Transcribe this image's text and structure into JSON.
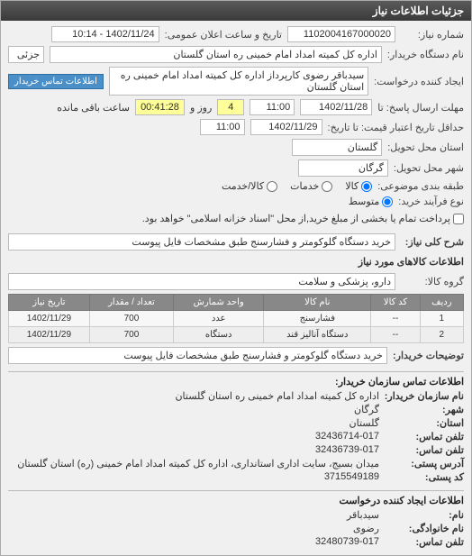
{
  "window": {
    "title": "جزئیات اطلاعات نیاز"
  },
  "header": {
    "reqNoLabel": "شماره نیاز:",
    "reqNo": "1102004167000020",
    "pubLabel": "تاریخ و ساعت اعلان عمومی:",
    "pubValue": "1402/11/24 - 10:14",
    "buyerDevLabel": "نام دستگاه خریدار:",
    "buyerDev": "اداره کل کمیته امداد امام خمینی  ره  استان گلستان",
    "partial": "جزئی",
    "creatorLabel": "ایجاد کننده درخواست:",
    "creator": "سیدباقر رضوی کارپرداز اداره کل کمیته امداد امام خمینی  ره  استان گلستان",
    "contactBtn": "اطلاعات تماس خریدار",
    "deadlineLabel": "مهلت ارسال پاسخ: تا",
    "deadlineDate": "1402/11/28",
    "deadlineTime": "11:00",
    "daysLeft": "4",
    "daysLeftSuffix": "روز و",
    "timeLeft": "00:41:28",
    "timeLeftSuffix": "ساعت باقی مانده",
    "validityLabel": "حداقل تاریخ اعتبار قیمت: تا تاریخ:",
    "validityDate": "1402/11/29",
    "validityTime": "11:00",
    "provinceLabel": "استان محل تحویل:",
    "province": "گلستان",
    "cityLabel": "شهر محل تحویل:",
    "city": "گرگان",
    "catLabel": "طبقه بندی موضوعی:",
    "catKala": "کالا",
    "catKhadamat": "خدمات",
    "catKalaKhadamat": "کالا/خدمت",
    "procLabel": "نوع فرآیند خرید:",
    "procMid": "متوسط",
    "procNote": "پرداخت تمام یا بخشی از مبلغ خرید,از محل \"اسناد خزانه اسلامی\" خواهد بود.",
    "descLabel": "شرح کلی نیاز:",
    "desc": "خرید دستگاه گلوکومتر و فشارسنج طبق مشخصات فایل پیوست"
  },
  "itemsSection": {
    "title": "اطلاعات کالاهای مورد نیاز",
    "groupLabel": "گروه کالا:",
    "group": "دارو، پزشکی و سلامت",
    "cols": {
      "row": "ردیف",
      "code": "کد کالا",
      "name": "نام کالا",
      "unit": "واحد شمارش",
      "qty": "تعداد / مقدار",
      "date": "تاریخ نیاز"
    },
    "rows": [
      {
        "n": "1",
        "code": "--",
        "name": "فشارسنج",
        "unit": "عدد",
        "qty": "700",
        "date": "1402/11/29"
      },
      {
        "n": "2",
        "code": "--",
        "name": "دستگاه آنالیز قند",
        "unit": "دستگاه",
        "qty": "700",
        "date": "1402/11/29"
      }
    ],
    "buyerNoteLabel": "توضیحات خریدار:",
    "buyerNote": "خرید دستگاه گلوکومتر و فشارسنج طبق مشخصات فایل پیوست"
  },
  "orgContact": {
    "title": "اطلاعات تماس سازمان خریدار:",
    "orgLabel": "نام سازمان خریدار:",
    "org": "اداره کل کمیته امداد امام خمینی ره استان گلستان",
    "cityLabel": "شهر:",
    "city": "گرگان",
    "provLabel": "استان:",
    "prov": "گلستان",
    "telLabel": "تلفن تماس:",
    "tel": "32436714-017",
    "faxLabel": "تلفن تماس:",
    "fax": "32436739-017",
    "addrLabel": "آدرس پستی:",
    "addr": "میدان بسیج، سایت اداری استانداری، اداره کل کمیته امداد امام خمینی (ره) استان گلستان",
    "postLabel": "کد پستی:",
    "post": "3715549189"
  },
  "reqCreator": {
    "title": "اطلاعات ایجاد کننده درخواست",
    "fnLabel": "نام:",
    "fn": "سیدباقر",
    "lnLabel": "نام خانوادگی:",
    "ln": "رضوی",
    "telLabel": "تلفن تماس:",
    "tel": "32480739-017"
  }
}
